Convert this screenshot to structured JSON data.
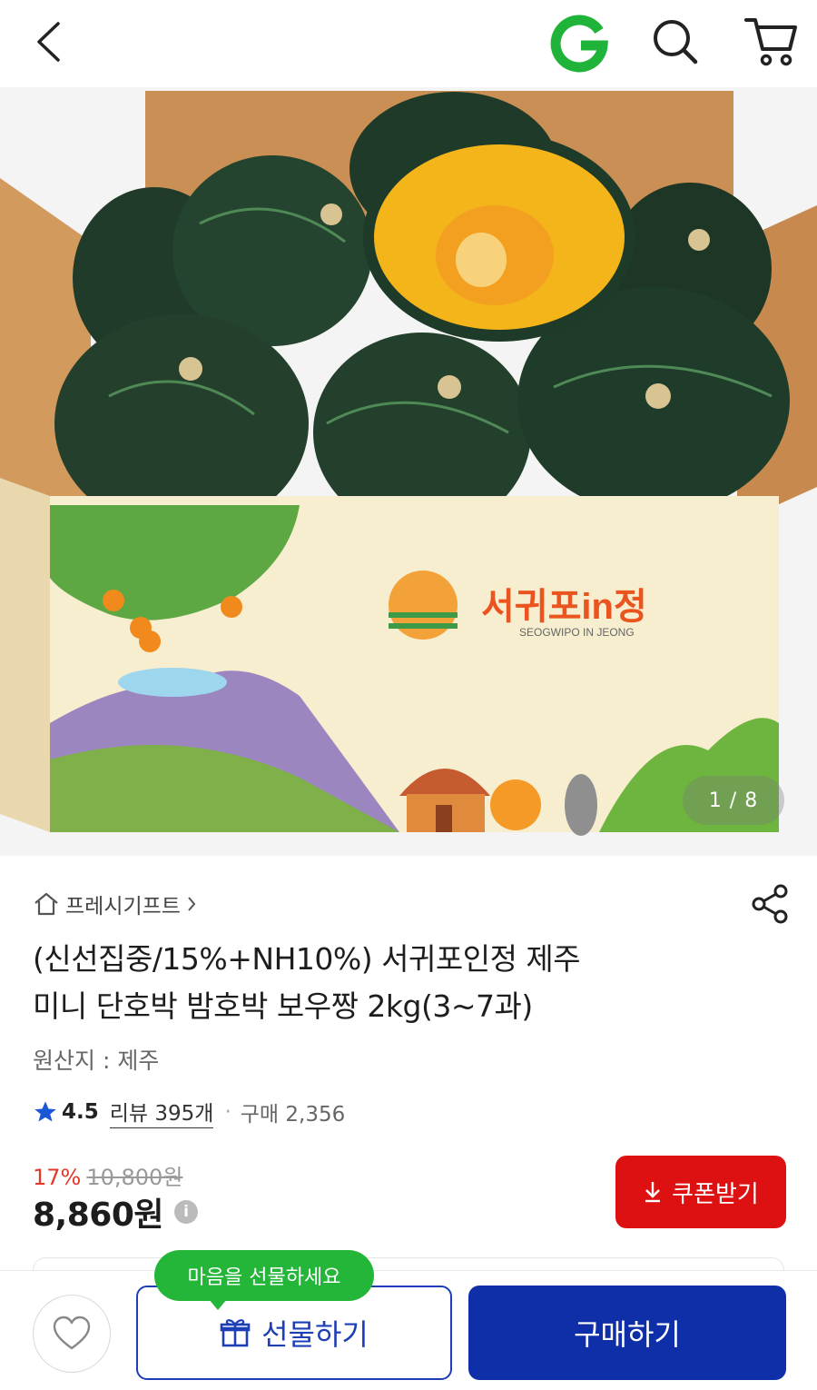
{
  "header": {
    "back_icon": "chevron-left-icon",
    "logo_letter": "G",
    "logo_color": "#1fb33a",
    "search_icon": "search-icon",
    "cart_icon": "cart-icon"
  },
  "hero": {
    "counter": "1 / 8",
    "box_brand": "서귀포in정",
    "box_brand_en": "SEOGWIPO IN JEONG"
  },
  "product": {
    "category": "프레시기프트",
    "title_line1": "(신선집중/15%+NH10%) 서귀포인정 제주",
    "title_line2": "미니 단호박 밤호박 보우짱 2kg(3~7과)",
    "origin": "원산지 : 제주",
    "rating": "4.5",
    "review_label": "리뷰 395개",
    "purchase_label": "구매 2,356",
    "discount_rate": "17%",
    "original_price": "10,800원",
    "price": "8,860원",
    "coupon_label": "쿠폰받기"
  },
  "bottom_bar": {
    "gift_tooltip": "마음을 선물하세요",
    "gift_label": "선물하기",
    "buy_label": "구매하기"
  },
  "colors": {
    "accent_blue": "#0f2fa8",
    "coupon_red": "#dd1111",
    "discount_red": "#e4382a",
    "tooltip_green": "#23b638",
    "star_blue": "#1a56d6"
  }
}
